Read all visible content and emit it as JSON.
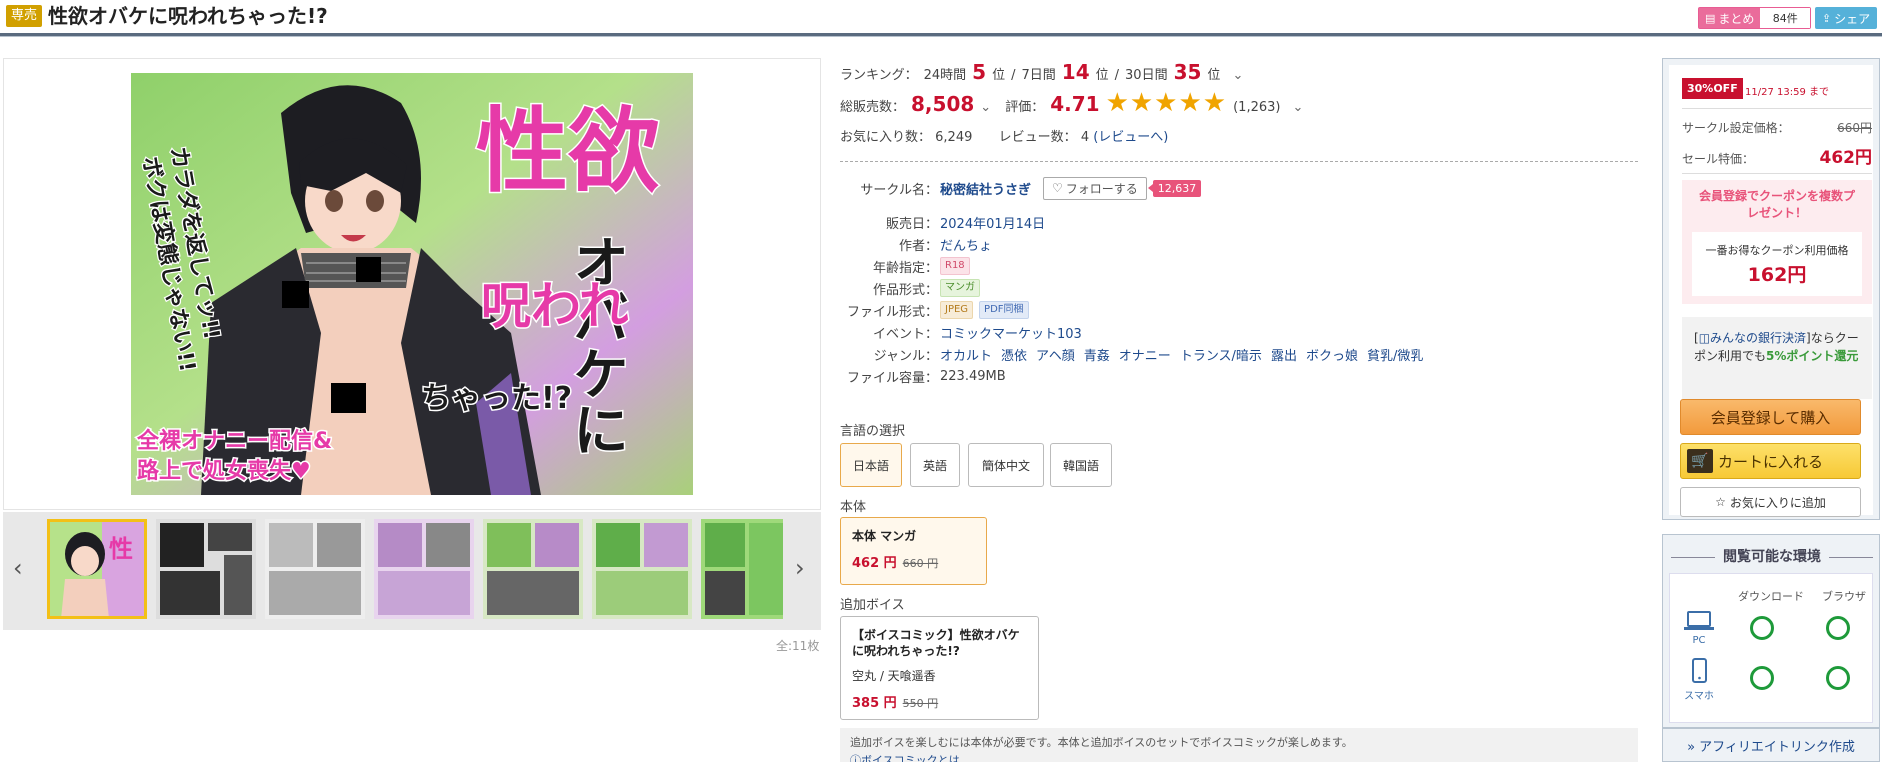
{
  "header": {
    "badge": "専売",
    "title": "性欲オバケに呪われちゃった!?",
    "matome_label": "まとめ",
    "matome_count": "84件",
    "share_label": "シェア"
  },
  "gallery": {
    "count_text": "全:11枚",
    "thumb_count": 7
  },
  "cover_art": {
    "title_large": "性欲",
    "title_vertical": "オバケに",
    "title_sub": "呪われ",
    "title_end": "ちゃった!?",
    "tagline_1": "カラダを返してッ!!",
    "tagline_2": "ボクは変態じゃない!!",
    "blurb_1": "全裸オナニー配信&",
    "blurb_2": "路上で処女喪失♥"
  },
  "ranking": {
    "label": "ランキング：",
    "p24_label": "24時間",
    "p24_value": "5",
    "p7_label": "7日間",
    "p7_value": "14",
    "p30_label": "30日間",
    "p30_value": "35",
    "unit": "位",
    "sep": "/"
  },
  "sales": {
    "total_label": "総販売数：",
    "total_value": "8,508",
    "rating_label": "評価：",
    "rating_value": "4.71",
    "rating_stars": 4.71,
    "rating_count": "(1,263)"
  },
  "favorites": {
    "fav_label": "お気に入り数：",
    "fav_value": "6,249",
    "review_label": "レビュー数：",
    "review_value": "4",
    "review_link": "(レビューへ)"
  },
  "specs": {
    "circle_label": "サークル名：",
    "circle_value": "秘密結社うさぎ",
    "follow_label": "フォローする",
    "follow_count": "12,637",
    "date_label": "販売日：",
    "date_value": "2024年01月14日",
    "author_label": "作者：",
    "author_value": "だんちょ",
    "age_label": "年齢指定：",
    "age_value": "R18",
    "format_label": "作品形式：",
    "format_value": "マンガ",
    "file_label": "ファイル形式：",
    "file_value_1": "JPEG",
    "file_value_2": "PDF同梱",
    "event_label": "イベント：",
    "event_value": "コミックマーケット103",
    "genre_label": "ジャンル：",
    "genres": [
      "オカルト",
      "憑依",
      "アヘ顔",
      "青姦",
      "オナニー",
      "トランス/暗示",
      "露出",
      "ボクっ娘",
      "貧乳/微乳"
    ],
    "size_label": "ファイル容量：",
    "size_value": "223.49MB"
  },
  "language": {
    "label": "言語の選択",
    "options": [
      "日本語",
      "英語",
      "簡体中文",
      "韓国語"
    ]
  },
  "main_product": {
    "section_label": "本体",
    "title": "本体 マンガ",
    "price": "462 円",
    "old_price": "660 円"
  },
  "voice_product": {
    "section_label": "追加ボイス",
    "title": "【ボイスコミック】性欲オバケに呪われちゃった!?",
    "cast": "空丸 / 天喰遥香",
    "price": "385 円",
    "old_price": "550 円"
  },
  "note": {
    "line1": "追加ボイスを楽しむには本体が必要です。本体と追加ボイスのセットでボイスコミックが楽しめます。",
    "line2": "ⓘボイスコミックとは"
  },
  "sidebar": {
    "off_badge": "30%OFF",
    "deadline": "11/27 13:59 まで",
    "set_price_label": "サークル設定価格：",
    "set_price": "660円",
    "sale_label": "セール特価：",
    "sale_price": "462円",
    "coupon_head": "会員登録でクーポンを複数プレゼント！",
    "coupon_sub": "一番お得なクーポン利用価格",
    "coupon_price": "162円",
    "bank_text_1": "[",
    "bank_link": "みんなの銀行決済",
    "bank_text_2": "]ならクーポン利用でも",
    "bank_highlight": "5%ポイント還元",
    "buy_label": "会員登録して購入",
    "cart_label": "カートに入れる",
    "fav_label": "お気に入りに追加",
    "env_title": "閲覧可能な環境",
    "env_download": "ダウンロード",
    "env_browser": "ブラウザ",
    "env_pc": "PC",
    "env_phone": "スマホ",
    "affiliate": "» アフィリエイトリンク作成"
  },
  "colors": {
    "accent_red": "#c8102e",
    "link_blue": "#1e4a8c",
    "star": "#f0a400",
    "pink": "#e8537a",
    "available_green": "#1e9a3a"
  }
}
